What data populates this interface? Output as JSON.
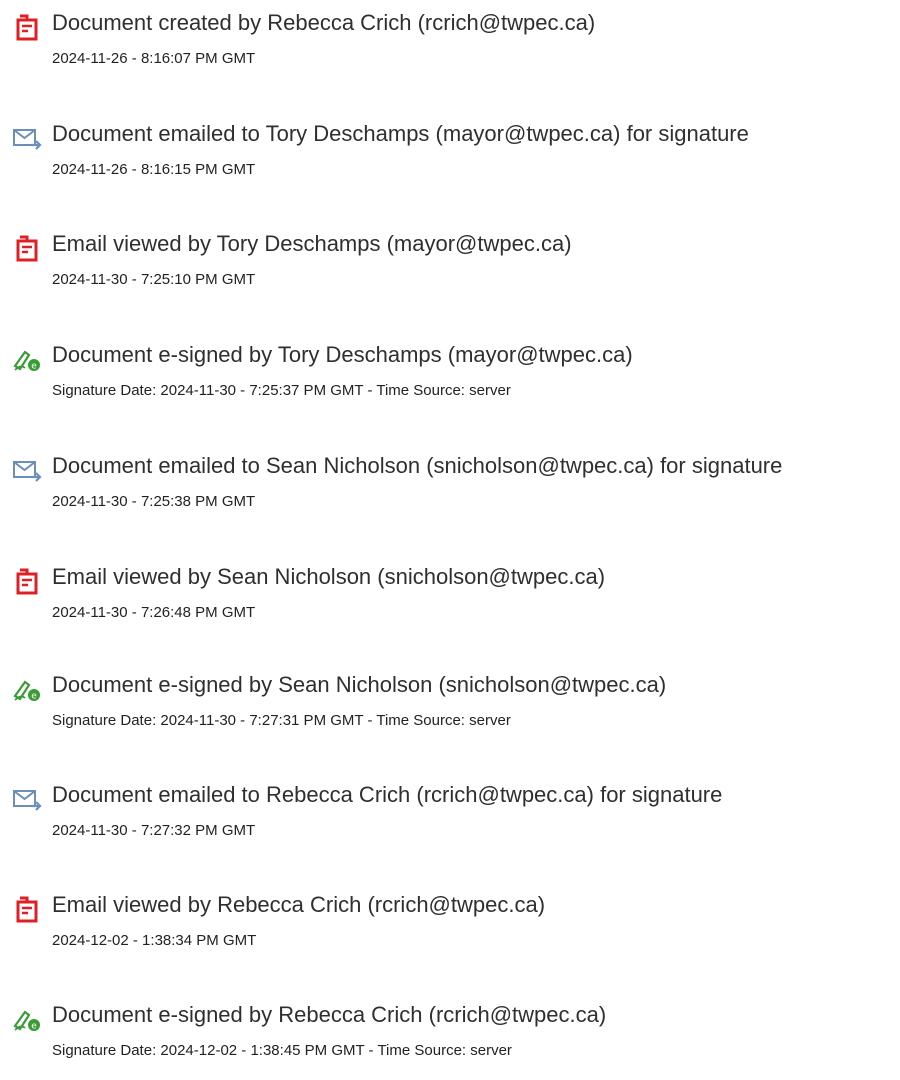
{
  "colors": {
    "pdf_icon": "#e01f25",
    "mail_icon": "#6a8fb8",
    "sign_icon": "#3a9c35",
    "text": "#2f2f2f"
  },
  "events": [
    {
      "icon": "pdf-icon",
      "title": "Document created by Rebecca Crich (rcrich@twpec.ca)",
      "timestamp": "2024-11-26 - 8:16:07 PM GMT"
    },
    {
      "icon": "email-icon",
      "title": "Document emailed to Tory Deschamps (mayor@twpec.ca) for signature",
      "timestamp": "2024-11-26 - 8:16:15 PM GMT"
    },
    {
      "icon": "pdf-icon",
      "title": "Email viewed by Tory Deschamps (mayor@twpec.ca)",
      "timestamp": "2024-11-30 - 7:25:10 PM GMT"
    },
    {
      "icon": "e-sign-icon",
      "title": "Document e-signed by Tory Deschamps (mayor@twpec.ca)",
      "timestamp": "Signature Date: 2024-11-30 - 7:25:37 PM GMT - Time Source: server"
    },
    {
      "icon": "email-icon",
      "title": "Document emailed to Sean Nicholson (snicholson@twpec.ca) for signature",
      "timestamp": "2024-11-30 - 7:25:38 PM GMT"
    },
    {
      "icon": "pdf-icon",
      "title": "Email viewed by Sean Nicholson (snicholson@twpec.ca)",
      "timestamp": "2024-11-30 - 7:26:48 PM GMT"
    },
    {
      "icon": "e-sign-icon",
      "title": "Document e-signed by Sean Nicholson (snicholson@twpec.ca)",
      "timestamp": "Signature Date: 2024-11-30 - 7:27:31 PM GMT - Time Source: server"
    },
    {
      "icon": "email-icon",
      "title": "Document emailed to Rebecca Crich (rcrich@twpec.ca) for signature",
      "timestamp": "2024-11-30 - 7:27:32 PM GMT"
    },
    {
      "icon": "pdf-icon",
      "title": "Email viewed by Rebecca Crich (rcrich@twpec.ca)",
      "timestamp": "2024-12-02 - 1:38:34 PM GMT"
    },
    {
      "icon": "e-sign-icon",
      "title": "Document e-signed by Rebecca Crich (rcrich@twpec.ca)",
      "timestamp": "Signature Date: 2024-12-02 - 1:38:45 PM GMT - Time Source: server"
    }
  ]
}
